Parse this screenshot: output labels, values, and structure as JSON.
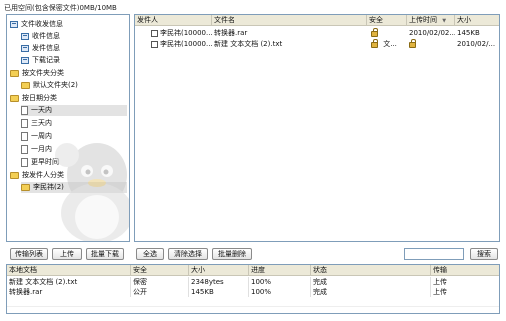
{
  "topbar": {
    "storage_text": "已用空间(包含保密文件)0MB/10MB"
  },
  "tree": {
    "sections": [
      {
        "label": "文件收发信息",
        "children": [
          "收件信息",
          "发件信息",
          "下载记录"
        ]
      },
      {
        "label": "按文件夹分类",
        "children": [
          "默认文件夹(2)"
        ]
      },
      {
        "label": "按日期分类",
        "children": [
          "一天内",
          "三天内",
          "一周内",
          "一月内",
          "更早时间"
        ]
      },
      {
        "label": "按发件人分类",
        "children": [
          "李民祎(2)"
        ]
      }
    ]
  },
  "filelist": {
    "headers": [
      "发件人",
      "文件名",
      "安全",
      "上传时间",
      "大小"
    ],
    "sort_indicator": "▼",
    "rows": [
      {
        "sender": "李民祎(10000...",
        "name": "转换器.rar",
        "security": "",
        "time": "2010/02/02...",
        "size": "145KB"
      },
      {
        "sender": "李民祎(10000...",
        "name": "新建 文本文档 (2).txt",
        "security": "文...",
        "time": "",
        "size": "2010/02/..."
      }
    ]
  },
  "buttons": {
    "transfer_list": "传输列表",
    "upload": "上传",
    "batch_download": "批量下载",
    "select_all": "全选",
    "clear_selection": "清除选择",
    "batch_delete": "批量删除",
    "search": "搜索"
  },
  "transfer": {
    "headers": [
      "本地文档",
      "安全",
      "大小",
      "进度",
      "状态",
      "传输"
    ],
    "rows": [
      [
        "新建 文本文档 (2).txt",
        "保密",
        "2348ytes",
        "100%",
        "完成",
        "上传"
      ],
      [
        "转换器.rar",
        "公开",
        "145KB",
        "100%",
        "完成",
        "上传"
      ]
    ]
  }
}
